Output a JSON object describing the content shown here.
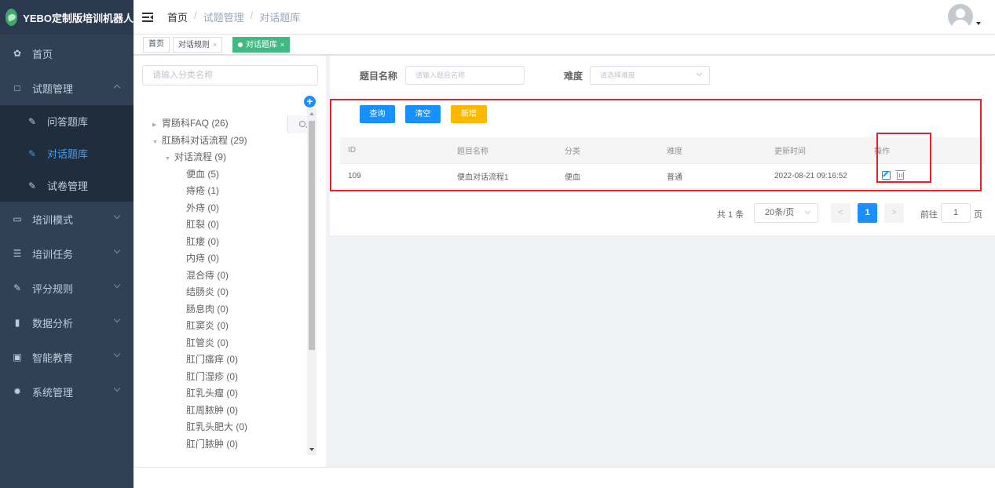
{
  "app": {
    "title": "YEBO定制版培训机器人"
  },
  "sidebar": {
    "items": [
      {
        "label": "首页",
        "icon": "dashboard-icon"
      },
      {
        "label": "试题管理",
        "icon": "book-icon",
        "expanded": true,
        "children": [
          {
            "label": "问答题库",
            "icon": "edit-icon"
          },
          {
            "label": "对话题库",
            "icon": "edit-icon",
            "active": true
          },
          {
            "label": "试卷管理",
            "icon": "edit-icon"
          }
        ]
      },
      {
        "label": "培训模式",
        "icon": "monitor-icon"
      },
      {
        "label": "培训任务",
        "icon": "list-icon"
      },
      {
        "label": "评分规则",
        "icon": "edit-icon"
      },
      {
        "label": "数据分析",
        "icon": "bar-chart-icon"
      },
      {
        "label": "智能教育",
        "icon": "screen-icon"
      },
      {
        "label": "系统管理",
        "icon": "gear-icon"
      }
    ]
  },
  "breadcrumb": [
    "首页",
    "试题管理",
    "对话题库"
  ],
  "tags": [
    {
      "label": "首页"
    },
    {
      "label": "对话规则",
      "close": "×"
    },
    {
      "label": "对话题库",
      "close": "×",
      "active": true
    }
  ],
  "tree": {
    "search_placeholder": "请输入分类名称",
    "add_label": "+",
    "nodes": [
      {
        "label": "胃肠科FAQ (26)",
        "level": 0,
        "state": "collapsed"
      },
      {
        "label": "肛肠科对话流程 (29)",
        "level": 0,
        "state": "expanded"
      },
      {
        "label": "对话流程 (9)",
        "level": 1,
        "state": "expanded"
      },
      {
        "label": "便血 (5)",
        "level": 2
      },
      {
        "label": "痔疮 (1)",
        "level": 2
      },
      {
        "label": "外痔 (0)",
        "level": 2
      },
      {
        "label": "肛裂 (0)",
        "level": 2
      },
      {
        "label": "肛瘘 (0)",
        "level": 2
      },
      {
        "label": "内痔 (0)",
        "level": 2
      },
      {
        "label": "混合痔 (0)",
        "level": 2
      },
      {
        "label": "结肠炎 (0)",
        "level": 2
      },
      {
        "label": "肠息肉 (0)",
        "level": 2
      },
      {
        "label": "肛窦炎 (0)",
        "level": 2
      },
      {
        "label": "肛管炎 (0)",
        "level": 2
      },
      {
        "label": "肛门瘙痒 (0)",
        "level": 2
      },
      {
        "label": "肛门湿疹 (0)",
        "level": 2
      },
      {
        "label": "肛乳头瘤 (0)",
        "level": 2
      },
      {
        "label": "肛周脓肿 (0)",
        "level": 2
      },
      {
        "label": "肛乳头肥大 (0)",
        "level": 2
      },
      {
        "label": "肛门脓肿 (0)",
        "level": 2
      }
    ]
  },
  "filters": {
    "title_label": "题目名称",
    "title_placeholder": "请输入题目名称",
    "difficulty_label": "难度",
    "difficulty_placeholder": "请选择难度"
  },
  "buttons": {
    "query": "查询",
    "clear": "清空",
    "add": "新增"
  },
  "table": {
    "headers": [
      "ID",
      "题目名称",
      "分类",
      "难度",
      "更新时间",
      "操作"
    ],
    "rows": [
      [
        "109",
        "便血对话流程1",
        "便血",
        "普通",
        "2022-08-21 09:16:52"
      ]
    ]
  },
  "pagination": {
    "total": "共 1 条",
    "page_size": "20条/页",
    "prev": "<",
    "current": "1",
    "next": ">",
    "goto_label": "前往",
    "goto_value": "1",
    "page_suffix": "页"
  },
  "colors": {
    "sidebar_bg": "#304156",
    "accent": "#1890ff",
    "tag_active": "#42b983",
    "add_button": "#ffb800",
    "highlight": "#e5202a"
  }
}
